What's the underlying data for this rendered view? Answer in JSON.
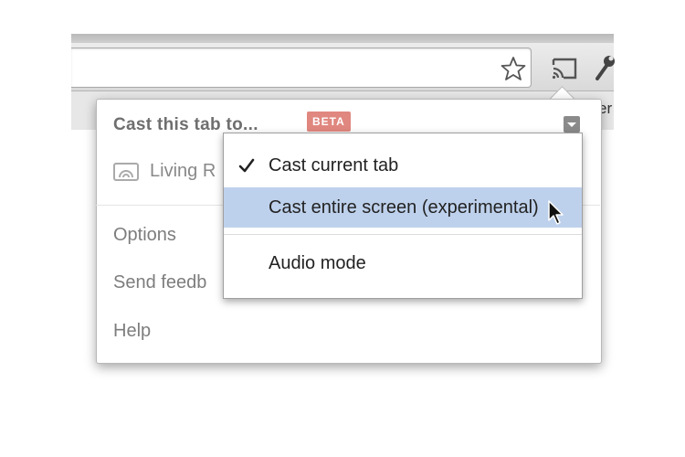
{
  "browser": {
    "toolbar_icons": [
      "star-icon",
      "cast-icon",
      "wrench-icon"
    ],
    "bookmark_bar_partial_text": "er"
  },
  "cast_popup": {
    "title": "Cast this tab to...",
    "badge": "BETA",
    "badge_color": "#e0877f",
    "device": {
      "icon": "cast-device-icon",
      "label": "Living R"
    },
    "links": {
      "options": "Options",
      "feedback": "Send feedb",
      "help": "Help"
    }
  },
  "cast_mode_menu": {
    "items": [
      {
        "label": "Cast current tab",
        "checked": true
      },
      {
        "label": "Cast entire screen (experimental)",
        "checked": false,
        "highlighted": true
      },
      {
        "label": "Audio mode",
        "checked": false
      }
    ],
    "highlight_color": "#bed1ec"
  }
}
